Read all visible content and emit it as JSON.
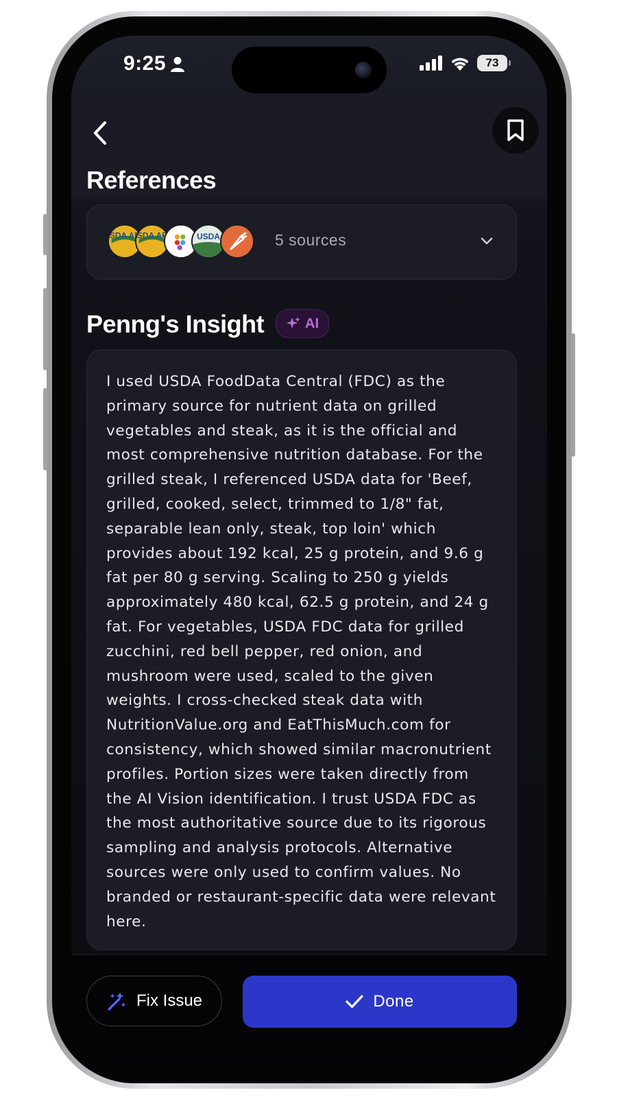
{
  "status_bar": {
    "time": "9:25",
    "battery": "73"
  },
  "header": {
    "back_icon": "chevron-left-icon",
    "bookmark_icon": "bookmark-icon"
  },
  "references": {
    "title": "References",
    "count_label": "5 sources",
    "sources": [
      {
        "icon": "usda-ars-logo",
        "text": "USDA ARS"
      },
      {
        "icon": "usda-ars-logo",
        "text": "USDA ARS"
      },
      {
        "icon": "fruit-grid-logo"
      },
      {
        "icon": "usda-logo",
        "text": "USDA"
      },
      {
        "icon": "carrot-logo"
      }
    ]
  },
  "insight": {
    "title": "Penng's Insight",
    "badge": "AI",
    "text": "I used USDA FoodData Central (FDC) as the primary source for nutrient data on grilled vegetables and steak, as it is the official and most comprehensive nutrition database. For the grilled steak, I referenced USDA data for 'Beef, grilled, cooked, select, trimmed to 1/8\" fat, separable lean only, steak, top loin' which provides about 192 kcal, 25 g protein, and 9.6 g fat per 80 g serving. Scaling to 250 g yields approximately 480 kcal, 62.5 g protein, and 24 g fat. For vegetables, USDA FDC data for grilled zucchini, red bell pepper, red onion, and mushroom were used, scaled to the given weights. I cross-checked steak data with NutritionValue.org and EatThisMuch.com for consistency, which showed similar macronutrient profiles. Portion sizes were taken directly from the AI Vision identification. I trust USDA FDC as the most authoritative source due to its rigorous sampling and analysis protocols. Alternative sources were only used to confirm values. No branded or restaurant-specific data were relevant here."
  },
  "actions": {
    "fix_label": "Fix Issue",
    "done_label": "Done"
  },
  "colors": {
    "accent": "#2c37c9",
    "ai_badge": "#b66ed8",
    "background": "#0b0c11",
    "card": "#1b1c24"
  }
}
